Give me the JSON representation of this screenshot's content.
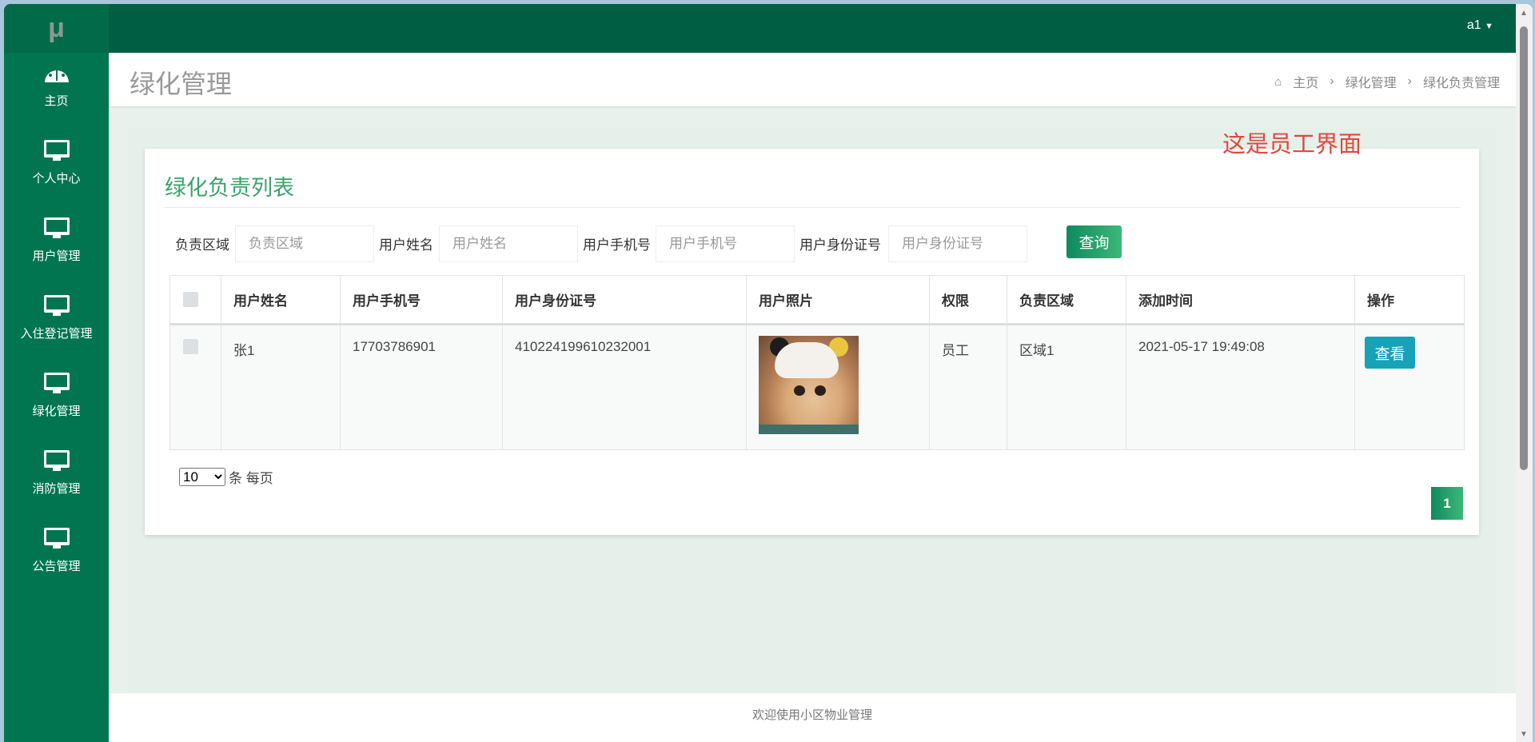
{
  "logo": "μ",
  "sidebar": {
    "items": [
      {
        "label": "主页",
        "icon": "dashboard-icon"
      },
      {
        "label": "个人中心",
        "icon": "monitor-icon"
      },
      {
        "label": "用户管理",
        "icon": "monitor-icon"
      },
      {
        "label": "入住登记管理",
        "icon": "monitor-icon"
      },
      {
        "label": "绿化管理",
        "icon": "monitor-icon"
      },
      {
        "label": "消防管理",
        "icon": "monitor-icon"
      },
      {
        "label": "公告管理",
        "icon": "monitor-icon"
      }
    ]
  },
  "topbar": {
    "user": "a1"
  },
  "header": {
    "title": "绿化管理",
    "breadcrumb": [
      "主页",
      "绿化管理",
      "绿化负责管理"
    ]
  },
  "notice": "这是员工界面",
  "card": {
    "title": "绿化负责列表",
    "search": [
      {
        "label": "负责区域",
        "placeholder": "负责区域"
      },
      {
        "label": "用户姓名",
        "placeholder": "用户姓名"
      },
      {
        "label": "用户手机号",
        "placeholder": "用户手机号"
      },
      {
        "label": "用户身份证号",
        "placeholder": "用户身份证号"
      }
    ],
    "query_button": "查询",
    "table": {
      "headers": [
        "用户姓名",
        "用户手机号",
        "用户身份证号",
        "用户照片",
        "权限",
        "负责区域",
        "添加时间",
        "操作"
      ],
      "rows": [
        {
          "name": "张1",
          "phone": "17703786901",
          "id_number": "410224199610232001",
          "permission": "员工",
          "area": "区域1",
          "added": "2021-05-17 19:49:08",
          "action": "查看"
        }
      ]
    },
    "per_page_value": "10",
    "per_page_label": "条 每页",
    "current_page": "1"
  },
  "footer": "欢迎使用小区物业管理",
  "colors": {
    "sidebar": "#007550",
    "topbar": "#005e43",
    "accent": "#3aa36b",
    "notice": "#e0483f",
    "info": "#17a2b8"
  }
}
